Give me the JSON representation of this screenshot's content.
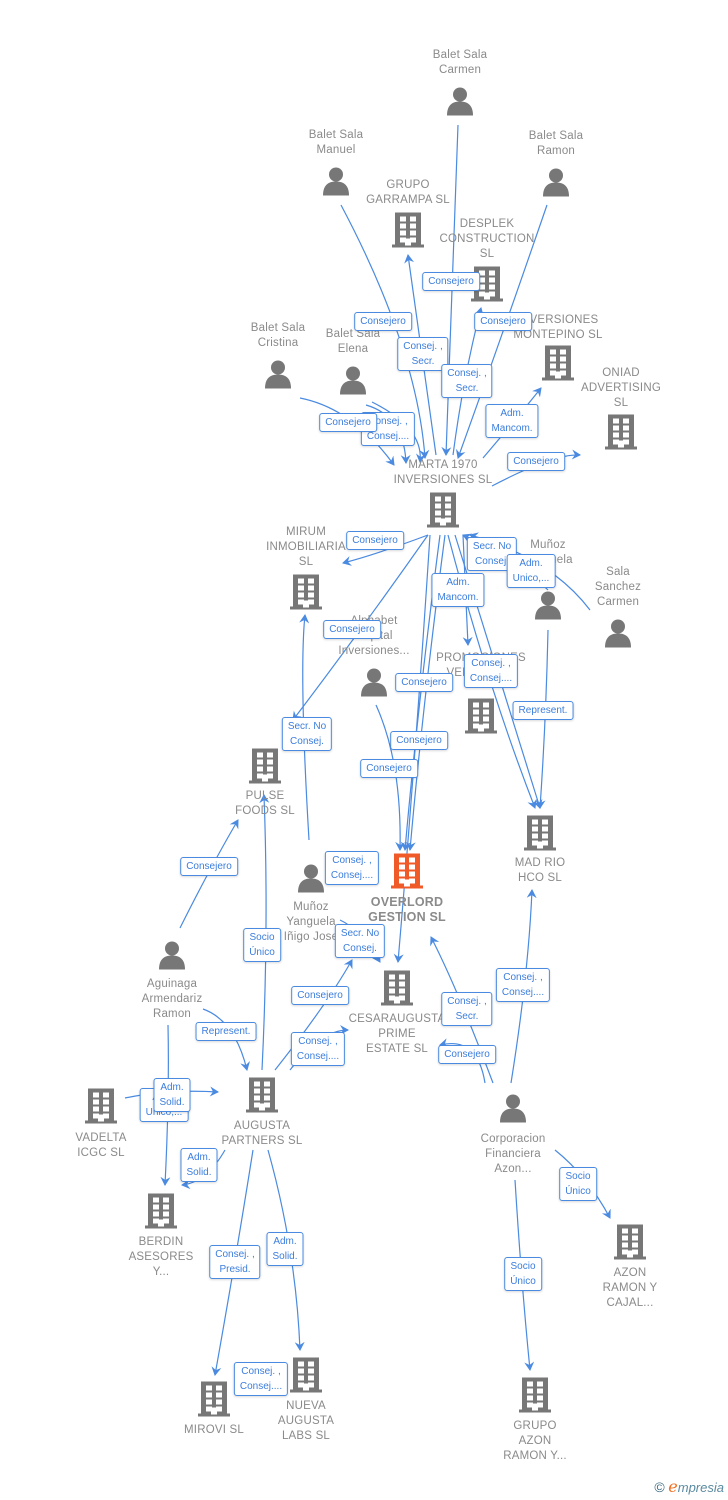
{
  "colors": {
    "edge": "#4a8ae0",
    "label_text": "#3b7ddd",
    "icon": "#777777",
    "highlight": "#f05a28",
    "node_text": "#8a8a8a"
  },
  "nodes": [
    {
      "type": "person",
      "label": [
        "Balet Sala",
        "Carmen"
      ]
    },
    {
      "type": "person",
      "label": [
        "Balet Sala",
        "Manuel"
      ]
    },
    {
      "type": "person",
      "label": [
        "Balet Sala",
        "Ramon"
      ]
    },
    {
      "type": "person",
      "label": [
        "Balet Sala",
        "Cristina"
      ]
    },
    {
      "type": "person",
      "label": [
        "Balet Sala",
        "Elena"
      ]
    },
    {
      "type": "person",
      "label": [
        "Muñoz",
        "Yanguela"
      ]
    },
    {
      "type": "person",
      "label": [
        "Sala",
        "Sanchez",
        "Carmen"
      ]
    },
    {
      "type": "person",
      "label": [
        "Alphabet",
        "Capital",
        "Inversiones..."
      ]
    },
    {
      "type": "person",
      "label": [
        "Muñoz",
        "Yanguela",
        "Iñigo Jose"
      ]
    },
    {
      "type": "person",
      "label": [
        "Aguinaga",
        "Armendariz",
        "Ramon"
      ]
    },
    {
      "type": "person",
      "label": [
        "Corporacion",
        "Financiera",
        "Azon..."
      ]
    },
    {
      "type": "company",
      "label": [
        "GRUPO",
        "GARRAMPA SL"
      ]
    },
    {
      "type": "company",
      "label": [
        "DESPLEK",
        "CONSTRUCTION",
        "SL"
      ]
    },
    {
      "type": "company",
      "label": [
        "INVERSIONES",
        "MONTEPINO SL"
      ]
    },
    {
      "type": "company",
      "label": [
        "ONIAD",
        "ADVERTISING",
        "SL"
      ]
    },
    {
      "type": "company",
      "label": [
        "MARTA 1970",
        "INVERSIONES SL"
      ]
    },
    {
      "type": "company",
      "label": [
        "MIRUM",
        "INMOBILIARIA",
        "SL"
      ]
    },
    {
      "type": "company",
      "label": [
        "PROMOCIONES",
        "VENECIA  SL"
      ]
    },
    {
      "type": "company",
      "label": [
        "PULSE",
        "FOODS  SL"
      ]
    },
    {
      "type": "company",
      "label": [
        "MAD RIO",
        "HCO  SL"
      ]
    },
    {
      "type": "company",
      "label": [
        "OVERLORD",
        "GESTION  SL"
      ],
      "highlighted": true
    },
    {
      "type": "company",
      "label": [
        "CESARAUGUSTA",
        "PRIME",
        "ESTATE  SL"
      ]
    },
    {
      "type": "company",
      "label": [
        "VADELTA",
        "ICGC  SL"
      ]
    },
    {
      "type": "company",
      "label": [
        "AUGUSTA",
        "PARTNERS  SL"
      ]
    },
    {
      "type": "company",
      "label": [
        "BERDIN",
        "ASESORES",
        "Y..."
      ]
    },
    {
      "type": "company",
      "label": [
        "AZON",
        "RAMON Y",
        "CAJAL..."
      ]
    },
    {
      "type": "company",
      "label": [
        "MIROVI  SL"
      ]
    },
    {
      "type": "company",
      "label": [
        "NUEVA",
        "AUGUSTA",
        "LABS  SL"
      ]
    },
    {
      "type": "company",
      "label": [
        "GRUPO",
        "AZON",
        "RAMON Y..."
      ]
    }
  ],
  "edge_labels": [
    [
      "Consejero"
    ],
    [
      "Consejero"
    ],
    [
      "Consejero"
    ],
    [
      "Consej. ,",
      "Secr."
    ],
    [
      "Consej. ,",
      "Secr."
    ],
    [
      "Consej. ,",
      "Consej...."
    ],
    [
      "Consejero"
    ],
    [
      "Adm.",
      "Mancom."
    ],
    [
      "Consejero"
    ],
    [
      "Consejero"
    ],
    [
      "Secr.  No",
      "Consej."
    ],
    [
      "Adm.",
      "Unico,..."
    ],
    [
      "Adm.",
      "Mancom."
    ],
    [
      "Consejero"
    ],
    [
      "Consej. ,",
      "Consej...."
    ],
    [
      "Consejero"
    ],
    [
      "Represent."
    ],
    [
      "Secr.  No",
      "Consej."
    ],
    [
      "Consejero"
    ],
    [
      "Consejero"
    ],
    [
      "Consejero"
    ],
    [
      "Consej. ,",
      "Consej...."
    ],
    [
      "Socio",
      "Único"
    ],
    [
      "Secr.  No",
      "Consej."
    ],
    [
      "Consejero"
    ],
    [
      "Consej. ,",
      "Secr."
    ],
    [
      "Consej. ,",
      "Consej...."
    ],
    [
      "Represent."
    ],
    [
      "Consej. ,",
      "Consej...."
    ],
    [
      "Consejero"
    ],
    [
      "Adm.",
      "Unico,..."
    ],
    [
      "Adm.",
      "Solid."
    ],
    [
      "Adm.",
      "Solid."
    ],
    [
      "Consej. ,",
      "Presid."
    ],
    [
      "Adm.",
      "Solid."
    ],
    [
      "Socio",
      "Único"
    ],
    [
      "Socio",
      "Único"
    ],
    [
      "Consej. ,",
      "Consej...."
    ]
  ],
  "watermark": {
    "copyright": "©",
    "brand_initial": "e",
    "brand_rest": "mpresia"
  }
}
